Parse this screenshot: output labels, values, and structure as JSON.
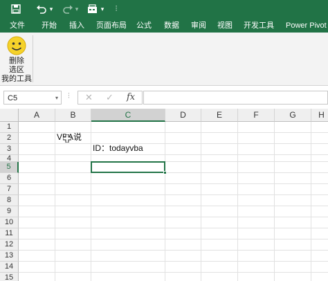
{
  "qat": {
    "save_icon": "save-icon",
    "undo_icon": "undo-icon",
    "redo_icon": "redo-icon",
    "custom_icon": "toolbar-icon",
    "dropdown_glyph": "▾",
    "more_glyph": "⫶"
  },
  "tabs": [
    "文件",
    "开始",
    "插入",
    "页面布局",
    "公式",
    "数据",
    "审阅",
    "视图",
    "开发工具",
    "Power Pivot"
  ],
  "ribbon": {
    "button_label_line1": "删除",
    "button_label_line2": "选区",
    "group_label": "我的工具"
  },
  "formula_bar": {
    "name_box": "C5",
    "cancel_glyph": "✕",
    "enter_glyph": "✓",
    "fx_glyph": "fx",
    "formula": ""
  },
  "columns": [
    "A",
    "B",
    "C",
    "D",
    "E",
    "F",
    "G",
    "H"
  ],
  "rows": [
    "1",
    "2",
    "3",
    "4",
    "5",
    "6",
    "7",
    "8",
    "9",
    "10",
    "11",
    "12",
    "13",
    "14",
    "15"
  ],
  "cells": {
    "B2": "VBA说",
    "C3": "ID：todayvba"
  },
  "selection": {
    "active_column": "C",
    "active_row": "5"
  },
  "colors": {
    "accent": "#217346"
  }
}
